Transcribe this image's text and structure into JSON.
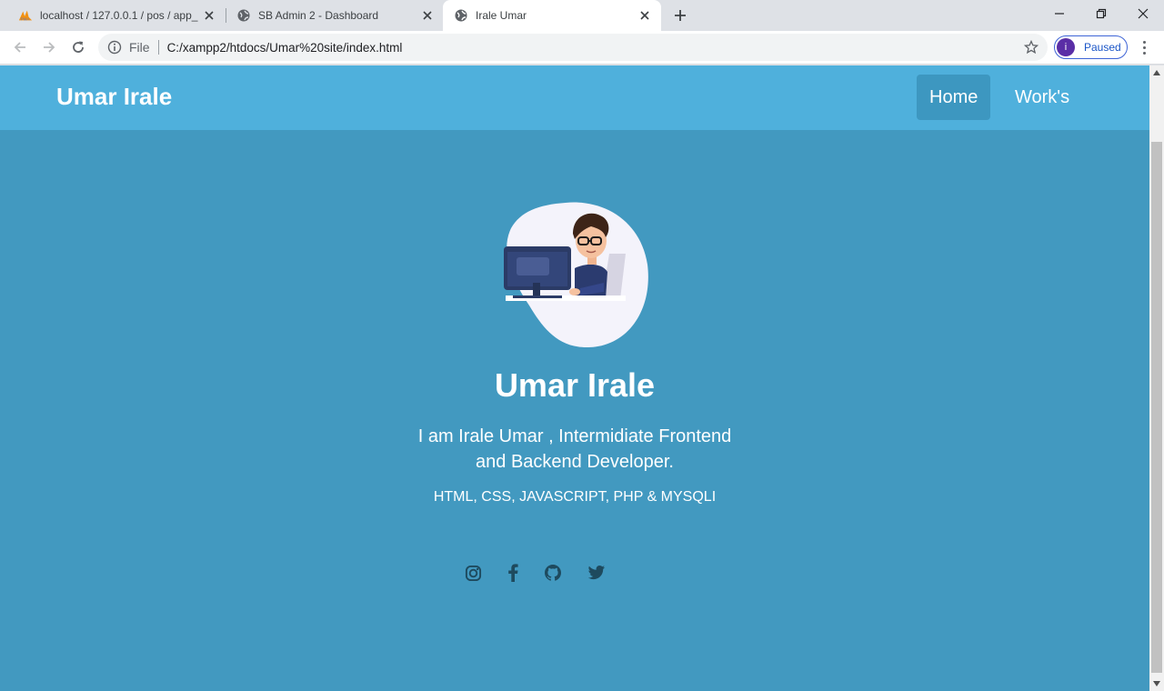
{
  "browser": {
    "tabs": [
      {
        "title": "localhost / 127.0.0.1 / pos / app_",
        "icon": "phpmyadmin-icon",
        "active": false
      },
      {
        "title": "SB Admin 2 - Dashboard",
        "icon": "globe-icon",
        "active": false
      },
      {
        "title": "Irale Umar",
        "icon": "globe-icon",
        "active": true
      }
    ],
    "omnibox": {
      "scheme_label": "File",
      "url": "C:/xampp2/htdocs/Umar%20site/index.html"
    },
    "profile": {
      "initial": "i",
      "status": "Paused"
    }
  },
  "site": {
    "brand": "Umar Irale",
    "nav": [
      {
        "label": "Home",
        "active": true
      },
      {
        "label": "Work's",
        "active": false
      }
    ],
    "hero": {
      "name": "Umar Irale",
      "description": "I am Irale Umar , Intermidiate Frontend and Backend Developer.",
      "skills": "HTML, CSS, JAVASCRIPT, PHP & MYSQLI",
      "socials": [
        "instagram-icon",
        "facebook-icon",
        "github-icon",
        "twitter-icon"
      ]
    }
  },
  "colors": {
    "navbar": "#4fb0dc",
    "hero_bg": "#4299c0",
    "nav_active": "#3d97c0",
    "social_icon": "#1e4a5e"
  }
}
